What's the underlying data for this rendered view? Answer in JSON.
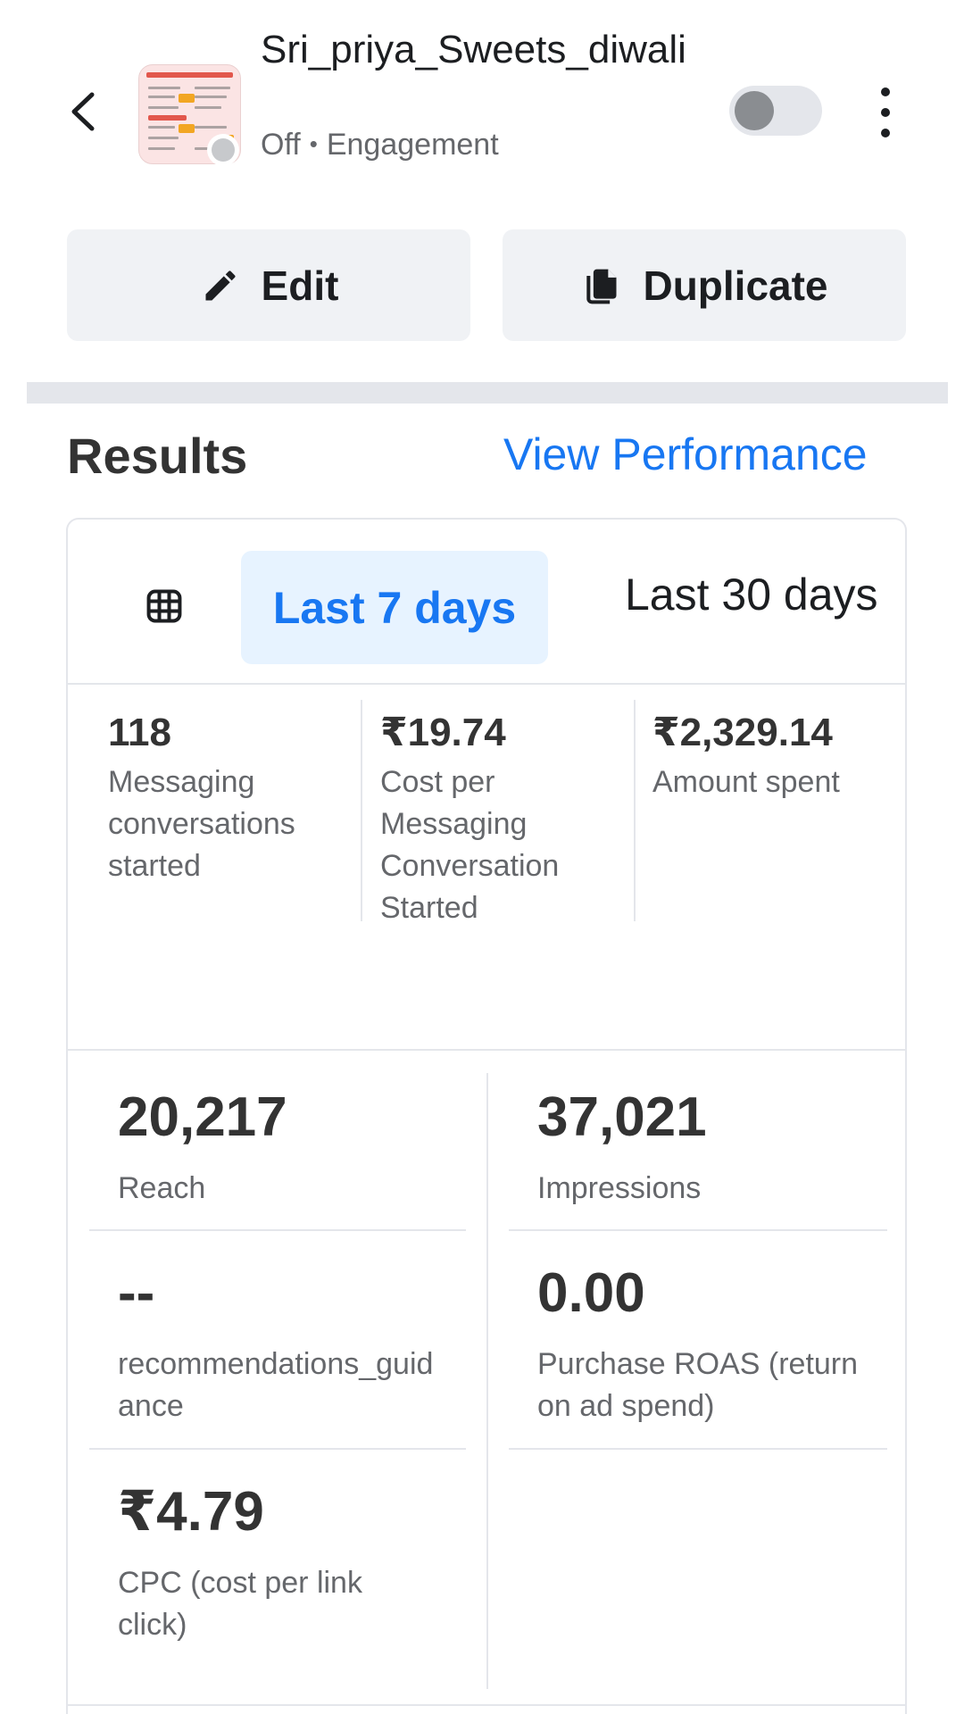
{
  "header": {
    "campaign_name": "Sri_priya_Sweets_diwali",
    "status": "Off",
    "separator": "•",
    "objective": "Engagement"
  },
  "icons": {
    "back": "chevron-left-icon",
    "more": "more-vertical-icon",
    "edit": "pencil-icon",
    "duplicate": "copy-icon",
    "calendar": "calendar-icon"
  },
  "toggle": {
    "on": false
  },
  "actions": {
    "edit_label": "Edit",
    "duplicate_label": "Duplicate"
  },
  "results": {
    "title": "Results",
    "view_performance": "View Performance"
  },
  "tabs": {
    "last_7": "Last 7 days",
    "last_30": "Last 30 days",
    "selected": "Last 7 days"
  },
  "top_metrics": [
    {
      "value": "118",
      "label": "Messaging conversations started"
    },
    {
      "value": "₹19.74",
      "label": "Cost per Messaging Conversation Started"
    },
    {
      "value": "₹2,329.14",
      "label": "Amount spent"
    }
  ],
  "grid_metrics": [
    {
      "value": "20,217",
      "label": "Reach"
    },
    {
      "value": "37,021",
      "label": "Impressions"
    },
    {
      "value": "--",
      "label": "recommendations_guidance"
    },
    {
      "value": "0.00",
      "label": "Purchase ROAS (return on ad spend)"
    },
    {
      "value": "₹4.79",
      "label": "CPC (cost per link click)"
    }
  ],
  "colors": {
    "accent": "#1877f2",
    "tab_selected_bg": "#e7f3ff",
    "button_bg": "#f0f2f5",
    "text": "#1c1e21",
    "muted": "#65676b"
  }
}
